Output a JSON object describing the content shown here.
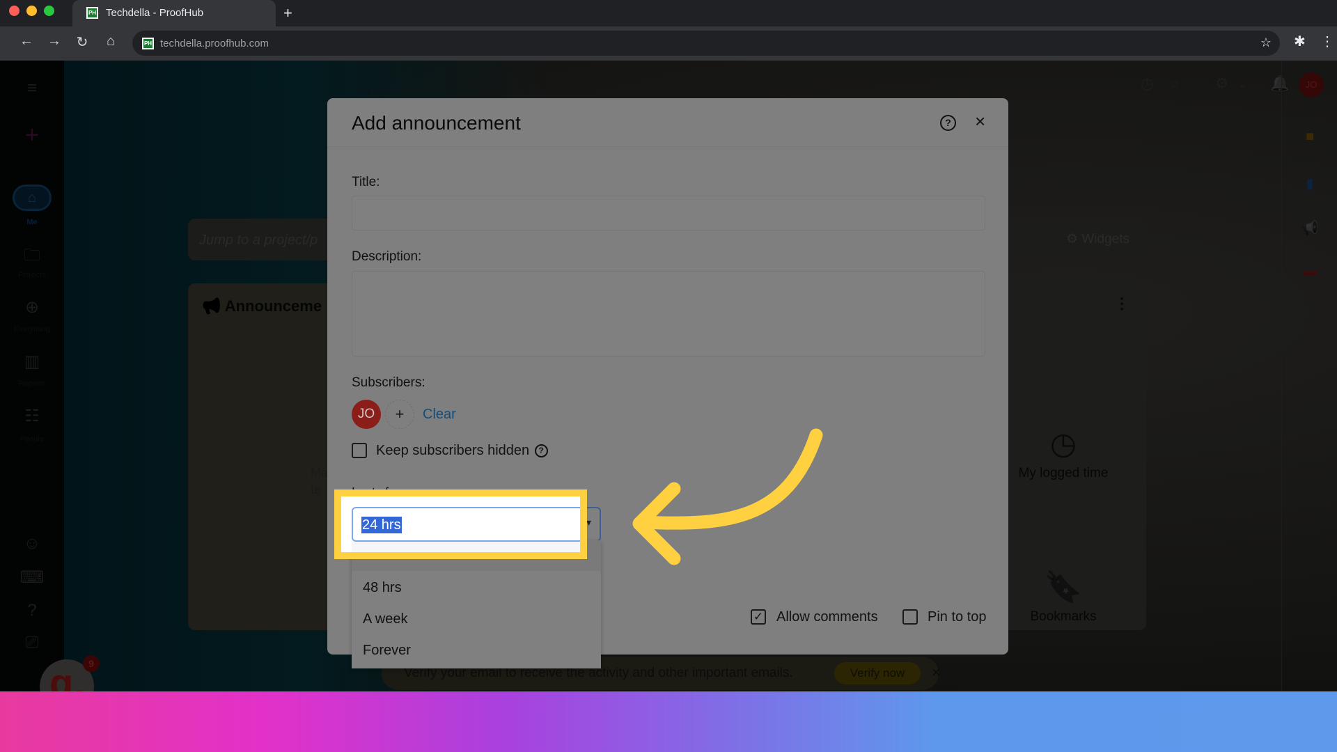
{
  "browser": {
    "tab_title": "Techdella - ProofHub",
    "favicon_text": "PH",
    "new_tab": "+",
    "url": "techdella.proofhub.com",
    "nav": {
      "back": "←",
      "forward": "→",
      "reload": "↻",
      "home": "⌂"
    },
    "bookmark_star": "☆",
    "extensions_icon": "✱",
    "menu_icon": "⋮"
  },
  "app": {
    "left_nav": {
      "menu_icon": "≡",
      "add_icon": "+",
      "items": [
        {
          "label": "Me",
          "icon": "⌂"
        },
        {
          "label": "Projects",
          "icon": "🗀"
        },
        {
          "label": "Everything",
          "icon": "⊕"
        },
        {
          "label": "Reports",
          "icon": "▥"
        },
        {
          "label": "People",
          "icon": "☷"
        }
      ],
      "bottom_icons": [
        "☺",
        "⌨",
        "?",
        "⎚"
      ]
    },
    "top_icons": {
      "timer": "◷",
      "search": "⌕",
      "settings": "⚙",
      "settings_chevron": "⌄",
      "bell": "🔔",
      "avatar": "JO"
    },
    "jump_placeholder": "Jump to a project/p",
    "widgets_label": "Widgets",
    "widgets_icon": "⚙",
    "announcements_title": "Announceme",
    "announcements_icon": "📢",
    "announcements_partial_text": [
      "Ma",
      "te"
    ],
    "more_icon": "⋮",
    "widget_tiles": [
      {
        "label": "My logged time",
        "icon": "◷"
      },
      {
        "label": "Bookmarks",
        "icon": "🔖"
      }
    ],
    "right_rail_icons": [
      {
        "name": "notes",
        "glyph": "■",
        "color": "#3c2a05"
      },
      {
        "name": "bookmark",
        "glyph": "▮",
        "color": "#0c2440"
      },
      {
        "name": "announcement",
        "glyph": "📢",
        "color": "#1a1a1a"
      },
      {
        "name": "calendar",
        "glyph": "▬",
        "color": "#3a0d0d"
      }
    ],
    "verify_banner": {
      "message": "Verify your email to receive the activity and other important emails.",
      "button": "Verify now",
      "close": "×"
    },
    "g_badge": {
      "letter": "g.",
      "count": "9"
    },
    "chat_icon": "💬"
  },
  "modal": {
    "title": "Add announcement",
    "help_icon": "?",
    "close_icon": "×",
    "title_label": "Title:",
    "title_value": "",
    "description_label": "Description:",
    "description_value": "",
    "subscribers_label": "Subscribers:",
    "subscriber_avatar": "JO",
    "add_subscriber": "+",
    "clear_label": "Clear",
    "keep_hidden_label": "Keep subscribers hidden",
    "keep_hidden_checked": false,
    "lasts_for_label": "Lasts for:",
    "lasts_for_value": "24 hrs",
    "lasts_for_options": [
      "24 hrs",
      "48 hrs",
      "A week",
      "Forever"
    ],
    "allow_comments_label": "Allow comments",
    "allow_comments_checked": true,
    "pin_to_top_label": "Pin to top",
    "pin_to_top_checked": false,
    "check_glyph": "✓"
  },
  "annotation": {
    "highlight_color": "#ffd140"
  }
}
